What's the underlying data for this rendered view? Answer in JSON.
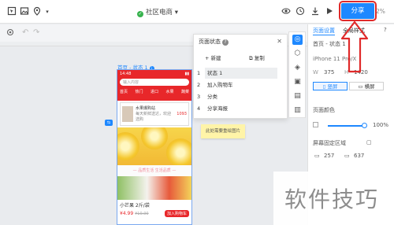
{
  "toolbar": {
    "project_name": "社区电商",
    "share_label": "分享",
    "zoom_text": "2%"
  },
  "canvas": {
    "page_label": "首页 - 状态 1",
    "note_text": "此处需要重绘图片"
  },
  "phone": {
    "time": "14:48",
    "search_placeholder": "输入内容",
    "nav_items": [
      "首页",
      "热门",
      "进口",
      "水果",
      "蔬菜"
    ],
    "promo_title": "水果爆购站",
    "promo_sub": "每天新鲜送达，欢迎选购",
    "promo_price": "1093",
    "banner_text": "— 品质生活 生活品质 —",
    "product_name": "小芒果 2斤/袋",
    "product_price": "¥4.99",
    "product_old_price": "¥10.00",
    "cart_button": "加入购物车"
  },
  "state_panel": {
    "title": "页面状态",
    "add_label": "+ 新建",
    "copy_label": "复制",
    "states": [
      {
        "num": "1",
        "label": "状态 1",
        "selected": true
      },
      {
        "num": "2",
        "label": "加入购物车",
        "selected": false
      },
      {
        "num": "3",
        "label": "分类",
        "selected": false
      },
      {
        "num": "4",
        "label": "分享海报",
        "selected": false
      }
    ]
  },
  "right_panel": {
    "tab_page": "页面设置",
    "tab_global": "全局样式",
    "page_name": "首页 - 状态 1",
    "device": "iPhone 11 Pro/X",
    "w_label": "W",
    "w_value": "375",
    "h_label": "H",
    "h_value": "1420",
    "portrait": "竖屏",
    "landscape": "横屏",
    "bg_label": "页面颜色",
    "opacity": "100%",
    "safe_area_label": "屏幕固定区域",
    "safe_top": "257",
    "safe_bottom": "637"
  },
  "watermark": "软件技巧",
  "colors": {
    "accent": "#1e88ff",
    "annotation": "#e02a2a",
    "brand_red": "#e8272a",
    "note_yellow": "#fff4a8"
  }
}
